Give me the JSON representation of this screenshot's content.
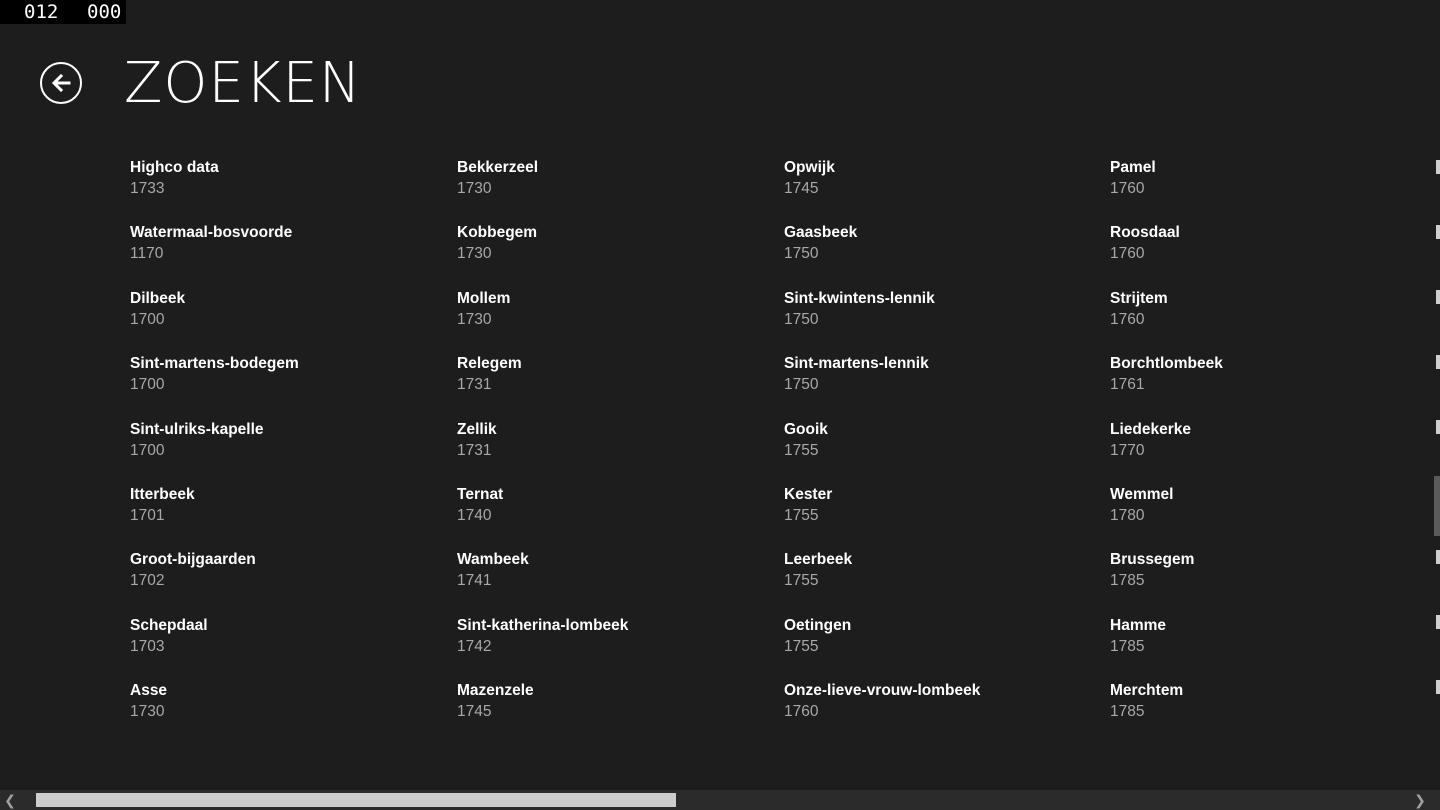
{
  "counter": {
    "left": "012",
    "right": "000"
  },
  "header": {
    "title": "ZOEKEN"
  },
  "results": {
    "columns": [
      [
        {
          "name": "Highco data",
          "code": "1733"
        },
        {
          "name": "Watermaal-bosvoorde",
          "code": "1170"
        },
        {
          "name": "Dilbeek",
          "code": "1700"
        },
        {
          "name": "Sint-martens-bodegem",
          "code": "1700"
        },
        {
          "name": "Sint-ulriks-kapelle",
          "code": "1700"
        },
        {
          "name": "Itterbeek",
          "code": "1701"
        },
        {
          "name": "Groot-bijgaarden",
          "code": "1702"
        },
        {
          "name": "Schepdaal",
          "code": "1703"
        },
        {
          "name": "Asse",
          "code": "1730"
        }
      ],
      [
        {
          "name": "Bekkerzeel",
          "code": "1730"
        },
        {
          "name": "Kobbegem",
          "code": "1730"
        },
        {
          "name": "Mollem",
          "code": "1730"
        },
        {
          "name": "Relegem",
          "code": "1731"
        },
        {
          "name": "Zellik",
          "code": "1731"
        },
        {
          "name": "Ternat",
          "code": "1740"
        },
        {
          "name": "Wambeek",
          "code": "1741"
        },
        {
          "name": "Sint-katherina-lombeek",
          "code": "1742"
        },
        {
          "name": "Mazenzele",
          "code": "1745"
        }
      ],
      [
        {
          "name": "Opwijk",
          "code": "1745"
        },
        {
          "name": "Gaasbeek",
          "code": "1750"
        },
        {
          "name": "Sint-kwintens-lennik",
          "code": "1750"
        },
        {
          "name": "Sint-martens-lennik",
          "code": "1750"
        },
        {
          "name": "Gooik",
          "code": "1755"
        },
        {
          "name": "Kester",
          "code": "1755"
        },
        {
          "name": "Leerbeek",
          "code": "1755"
        },
        {
          "name": "Oetingen",
          "code": "1755"
        },
        {
          "name": "Onze-lieve-vrouw-lombeek",
          "code": "1760"
        }
      ],
      [
        {
          "name": "Pamel",
          "code": "1760"
        },
        {
          "name": "Roosdaal",
          "code": "1760"
        },
        {
          "name": "Strijtem",
          "code": "1760"
        },
        {
          "name": "Borchtlombeek",
          "code": "1761"
        },
        {
          "name": "Liedekerke",
          "code": "1770"
        },
        {
          "name": "Wemmel",
          "code": "1780"
        },
        {
          "name": "Brussegem",
          "code": "1785"
        },
        {
          "name": "Hamme",
          "code": "1785"
        },
        {
          "name": "Merchtem",
          "code": "1785"
        }
      ]
    ]
  },
  "icons": {
    "back": "arrow-left-circle-icon",
    "scroll_left": "chevron-left-icon",
    "scroll_right": "chevron-right-icon"
  },
  "colors": {
    "background": "#1d1d1d",
    "primary_text": "#ffffff",
    "secondary_text": "#a8a8a8",
    "scrollbar_thumb": "#cdcdcd"
  }
}
